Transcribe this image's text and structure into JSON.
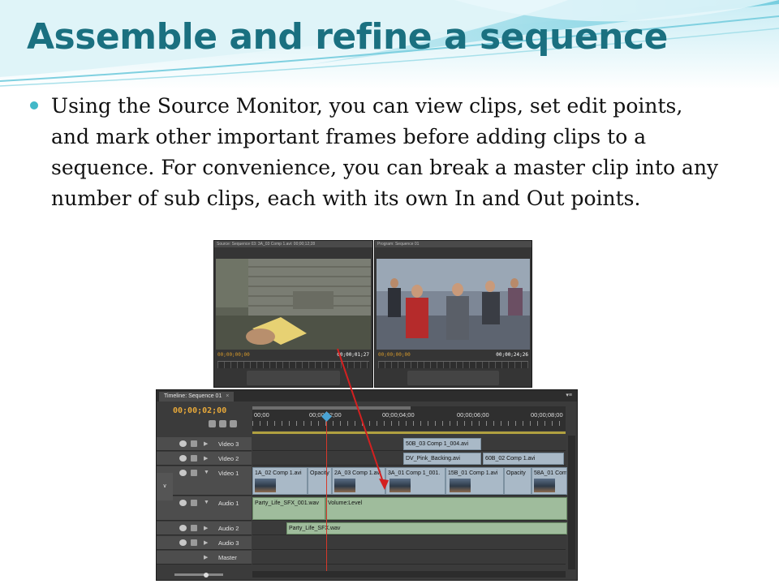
{
  "slide": {
    "title": "Assemble and refine a sequence",
    "bullet": "Using the Source Monitor, you can view clips, set edit points, and mark other important frames before adding clips to a sequence. For convenience, you can break a master clip into any number of sub clips, each with its own In and Out points."
  },
  "source_monitor": {
    "tab": "Source: Sequence 03: 3A_03 Comp 1.avi: 00;00;12;28",
    "timecode_in": "00;00;00;00",
    "timecode_out": "00;00;01;27"
  },
  "program_monitor": {
    "tab": "Program: Sequence 01",
    "timecode_in": "00;00;00;00",
    "timecode_out": "00;00;24;26"
  },
  "timeline": {
    "tab": "Timeline: Sequence 01",
    "tab_close": "×",
    "timecode": "00;00;02;00",
    "ruler": [
      "00;00",
      "00;00;02;00",
      "00;00;04;00",
      "00;00;06;00",
      "00;00;08;00"
    ],
    "tracks": {
      "video3": "Video 3",
      "video2": "Video 2",
      "video1": "Video 1",
      "audio1": "Audio 1",
      "audio2": "Audio 2",
      "audio3": "Audio 3",
      "master": "Master"
    },
    "clips": {
      "v3_1": "50B_03 Comp 1_004.avi",
      "v2_1": "DV_Pink_Backing.avi",
      "v2_2": "60B_02 Comp 1.avi",
      "v1_1": "1A_02 Comp 1.avi",
      "v1_1b": "Opacity",
      "v1_2": "2A_03 Comp 1.avi",
      "v1_3": "3A_01 Comp 1_001.",
      "v1_4": "15B_01 Comp 1.avi",
      "v1_4b": "Opacity",
      "v1_5": "58A_01 Com",
      "a1_1": "Party_Life_SFX_001.wav",
      "a1_1b": "Volume:Level",
      "a2_1": "Party_Life_SFX.wav"
    }
  },
  "colors": {
    "title": "#1a7080",
    "bullet": "#41b8c8",
    "timecode": "#e8a93a",
    "video_clip": "#a9b9c7",
    "audio_clip": "#9fbc9c",
    "playhead": "#d6382a"
  }
}
